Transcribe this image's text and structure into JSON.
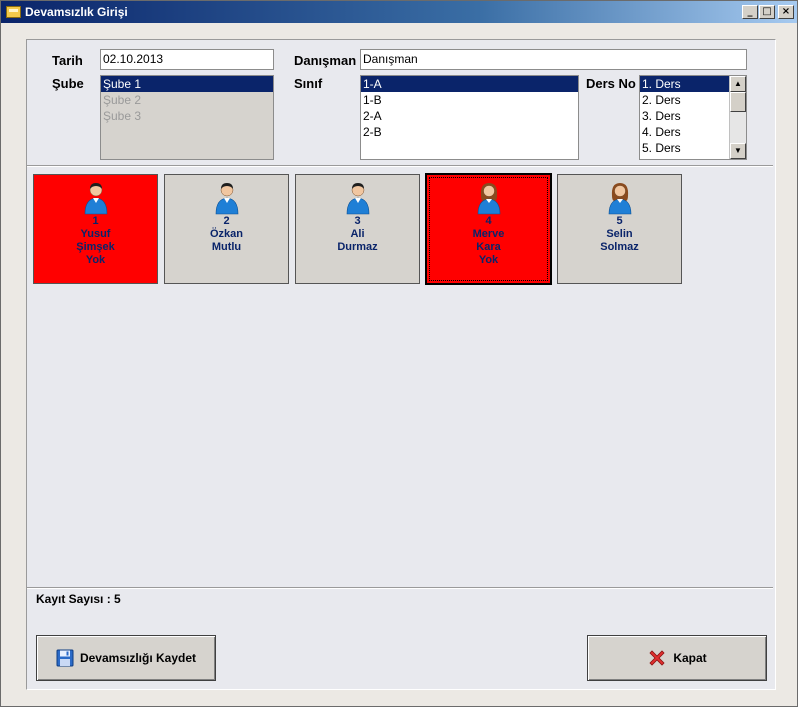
{
  "window": {
    "title": "Devamsızlık Girişi",
    "controls": {
      "minimize": "_",
      "maximize": "□",
      "close": "×"
    }
  },
  "form": {
    "tarih": {
      "label": "Tarih",
      "value": "02.10.2013"
    },
    "danisman": {
      "label": "Danışman",
      "value": "Danışman"
    },
    "sube": {
      "label": "Şube",
      "items": [
        "Şube 1",
        "Şube 2",
        "Şube 3"
      ],
      "selected_index": 0
    },
    "sinif": {
      "label": "Sınıf",
      "items": [
        "1-A",
        "1-B",
        "2-A",
        "2-B"
      ],
      "selected_index": 0
    },
    "ders_no": {
      "label": "Ders No",
      "items": [
        "1. Ders",
        "2. Ders",
        "3. Ders",
        "4. Ders",
        "5. Ders"
      ],
      "selected_index": 0
    }
  },
  "students": [
    {
      "no": "1",
      "first": "Yusuf",
      "last": "Şimşek",
      "status": "Yok",
      "absent": true,
      "gender": "male"
    },
    {
      "no": "2",
      "first": "Özkan",
      "last": "Mutlu",
      "status": "",
      "absent": false,
      "gender": "male"
    },
    {
      "no": "3",
      "first": "Ali",
      "last": "Durmaz",
      "status": "",
      "absent": false,
      "gender": "male"
    },
    {
      "no": "4",
      "first": "Merve",
      "last": "Kara",
      "status": "Yok",
      "absent": true,
      "gender": "female"
    },
    {
      "no": "5",
      "first": "Selin",
      "last": "Solmaz",
      "status": "",
      "absent": false,
      "gender": "female"
    }
  ],
  "footer": {
    "record_count": "Kayıt Sayısı : 5",
    "save_label": "Devamsızlığı Kaydet",
    "close_label": "Kapat"
  },
  "colors": {
    "absent_card": "#ff0000",
    "present_card": "#d6d3ce",
    "card_text": "#0a246a",
    "selection": "#0a246a",
    "icon_male": "save-icon",
    "icon_close": "close-icon"
  }
}
